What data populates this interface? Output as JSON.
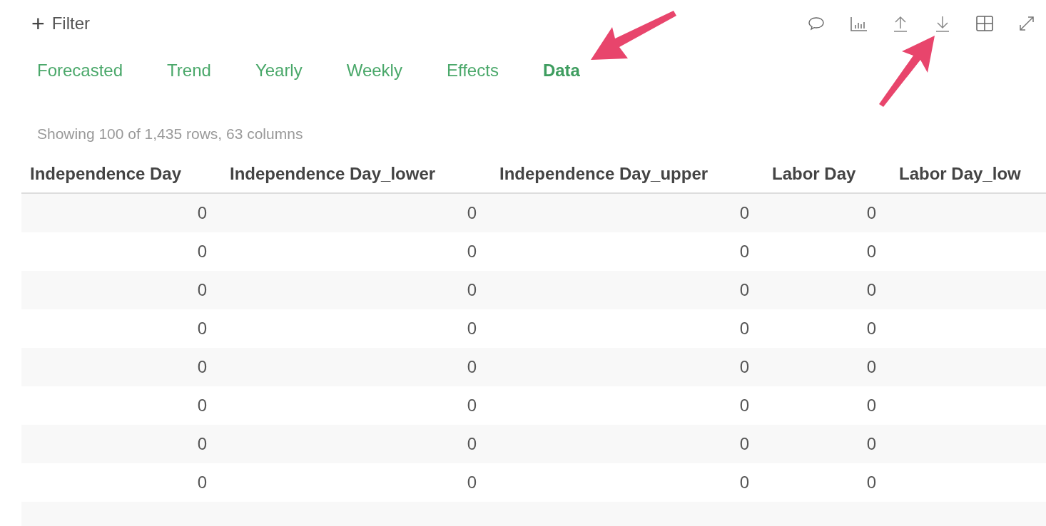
{
  "filter_button": {
    "icon": "+",
    "label": "Filter"
  },
  "tabs": [
    {
      "label": "Forecasted",
      "selected": false
    },
    {
      "label": "Trend",
      "selected": false
    },
    {
      "label": "Yearly",
      "selected": false
    },
    {
      "label": "Weekly",
      "selected": false
    },
    {
      "label": "Effects",
      "selected": false
    },
    {
      "label": "Data",
      "selected": true
    }
  ],
  "summary": "Showing 100 of 1,435 rows, 63 columns",
  "table": {
    "columns": [
      "Independence Day",
      "Independence Day_lower",
      "Independence Day_upper",
      "Labor Day",
      "Labor Day_low"
    ],
    "rows": [
      [
        "0",
        "0",
        "0",
        "0",
        ""
      ],
      [
        "0",
        "0",
        "0",
        "0",
        ""
      ],
      [
        "0",
        "0",
        "0",
        "0",
        ""
      ],
      [
        "0",
        "0",
        "0",
        "0",
        ""
      ],
      [
        "0",
        "0",
        "0",
        "0",
        ""
      ],
      [
        "0",
        "0",
        "0",
        "0",
        ""
      ],
      [
        "0",
        "0",
        "0",
        "0",
        ""
      ],
      [
        "0",
        "0",
        "0",
        "0",
        ""
      ]
    ]
  }
}
